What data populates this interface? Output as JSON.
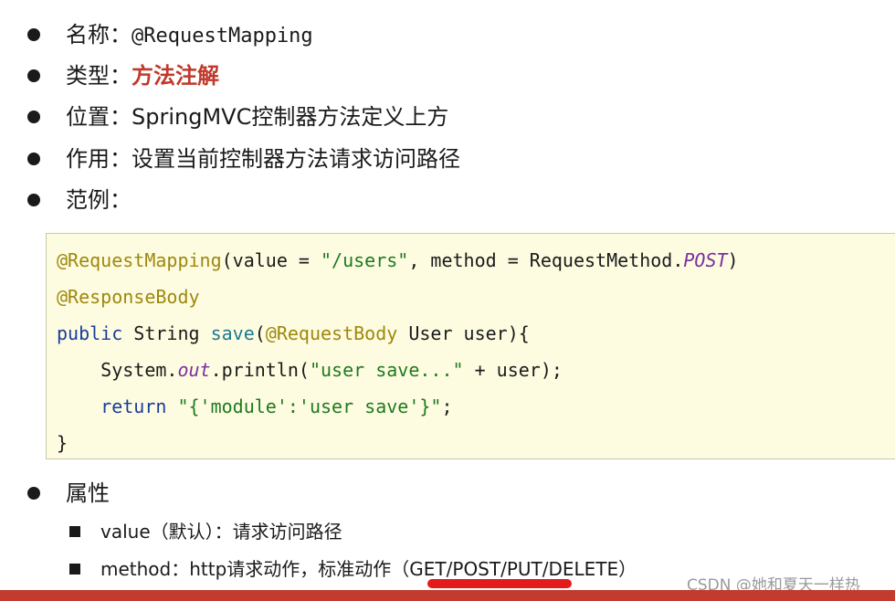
{
  "items": {
    "name_label": "名称：",
    "name_value": "@RequestMapping",
    "type_label": "类型：",
    "type_value": "方法注解",
    "position_label": "位置：",
    "position_value": "SpringMVC控制器方法定义上方",
    "function_label": "作用：",
    "function_value": "设置当前控制器方法请求访问路径",
    "example_label": "范例："
  },
  "code": {
    "l1_ann": "@RequestMapping",
    "l1_a": "(value = ",
    "l1_str": "\"/users\"",
    "l1_b": ", method = RequestMethod.",
    "l1_post": "POST",
    "l1_c": ")",
    "l2_ann": "@ResponseBody",
    "l3_kw": "public",
    "l3_a": " String ",
    "l3_m": "save",
    "l3_b": "(",
    "l3_ann": "@RequestBody",
    "l3_c": " User user){",
    "l4_a": "    System.",
    "l4_out": "out",
    "l4_b": ".println(",
    "l4_str": "\"user save...\"",
    "l4_c": " + user);",
    "l5_ind": "    ",
    "l5_kw": "return",
    "l5_sp": " ",
    "l5_str": "\"{'module':'user save'}\"",
    "l5_c": ";",
    "l6": "}"
  },
  "attributes": {
    "label": "属性",
    "value_line": "value（默认）：请求访问路径",
    "method_line": "method：http请求动作，标准动作（GET/POST/PUT/DELETE）"
  },
  "watermark": "CSDN @她和夏天一样热",
  "colors": {
    "type_value": "#c0392b",
    "code_background": "#fdfce1",
    "bottom_bar": "#c23b2e"
  }
}
